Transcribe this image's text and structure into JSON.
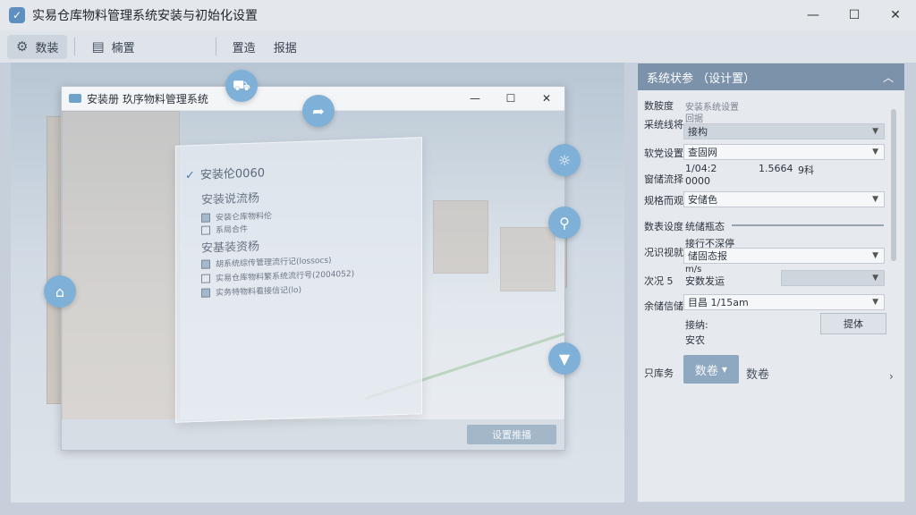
{
  "window": {
    "title": "实易仓库物料管理系统安装与初始化设置",
    "minimize": "—",
    "maximize": "☐",
    "close": "✕"
  },
  "toolbar": {
    "items": [
      {
        "label": "数装",
        "icon": "gear-icon"
      },
      {
        "label": "楠置",
        "icon": "document-icon"
      },
      {
        "label": "置造",
        "icon": ""
      },
      {
        "label": "报据",
        "icon": ""
      }
    ]
  },
  "inner_window": {
    "title": "安装册   玖序物料管理系统",
    "status": "安装伦0060",
    "section1": "安装说流杨",
    "items1": [
      "安装仑库物料伦",
      "系局合件"
    ],
    "section2": "安基装资杨",
    "items2": [
      "胡系统综传管理流行记(lossocs)",
      "实易仓库物料繁系统流行号(2004052)",
      "实务特物料看接信记(lo)"
    ],
    "apply_button": "设置推播"
  },
  "panel": {
    "title": "系统状参 （设计置）",
    "rows": [
      {
        "label": "数胺度",
        "value": "安装系统设置"
      },
      {
        "label": "采统线将",
        "sub": "回据",
        "value": "接构"
      },
      {
        "label": "软党设置",
        "value": "查固网"
      },
      {
        "label": "窗储流择",
        "value": "1/04:2",
        "value2": "1.5664",
        "value3": "9科",
        "sub": "0000"
      },
      {
        "label": "规格而观",
        "value": "安储色"
      },
      {
        "label": "数表设度",
        "value": "统储瓶态"
      },
      {
        "label": "况识视就",
        "sub": "接行不深停",
        "value": "储固态报"
      },
      {
        "label": "次况 5",
        "sub": "m/s",
        "value": "安数发运"
      },
      {
        "label": "余储信储",
        "value": "目昌 1/15am"
      },
      {
        "label": "",
        "sub": "接纳:",
        "value": "提体"
      },
      {
        "label": "",
        "sub": "安农"
      }
    ],
    "action_label": "只库务",
    "action_button": "数卷",
    "action_text": "数卷"
  },
  "colors": {
    "accent": "#7fb0d7",
    "panel_header": "#7c92aa"
  }
}
